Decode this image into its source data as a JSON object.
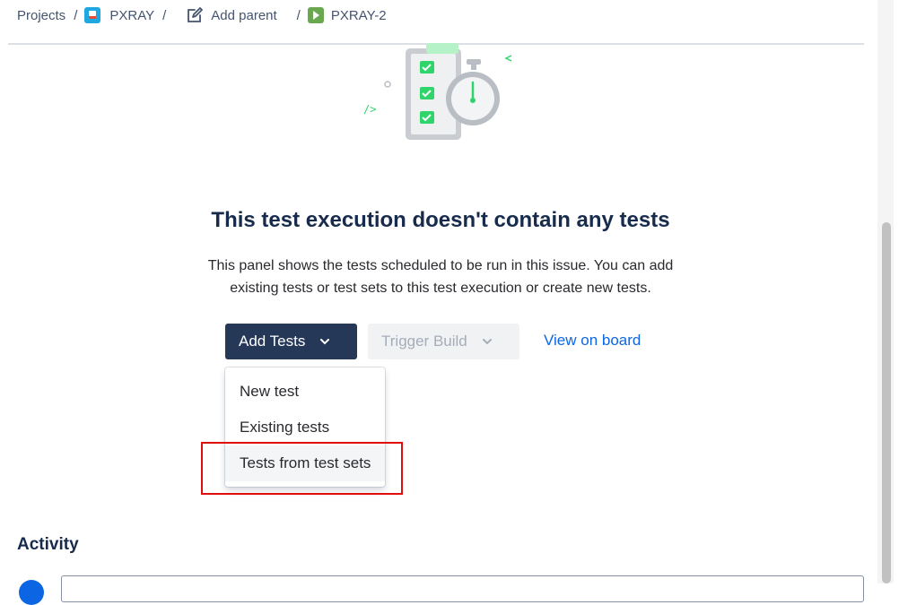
{
  "breadcrumb": {
    "projects": "Projects",
    "separator": "/",
    "project": "PXRAY",
    "add_parent": "Add parent",
    "issue_key": "PXRAY-2",
    "project_icon": "project-avatar-icon",
    "issue_icon": "test-execution-icon"
  },
  "empty_state": {
    "title": "This test execution doesn't contain any tests",
    "description_line1": "This panel shows the tests scheduled to be run in this issue. You can add",
    "description_line2": "existing tests or test sets to this test execution or create new tests."
  },
  "actions": {
    "add_tests": "Add Tests",
    "trigger_build": "Trigger Build",
    "view_on_board": "View on board",
    "chevron": "⌄"
  },
  "dropdown": {
    "items": [
      "New test",
      "Existing tests",
      "Tests from test sets"
    ],
    "hovered_item": "Tests from test sets"
  },
  "activity": {
    "title": "Activity"
  },
  "colors": {
    "primary_button": "#253858",
    "link": "#0c66e4",
    "highlight": "#e00d0d",
    "accent_green": "#22c55e"
  }
}
